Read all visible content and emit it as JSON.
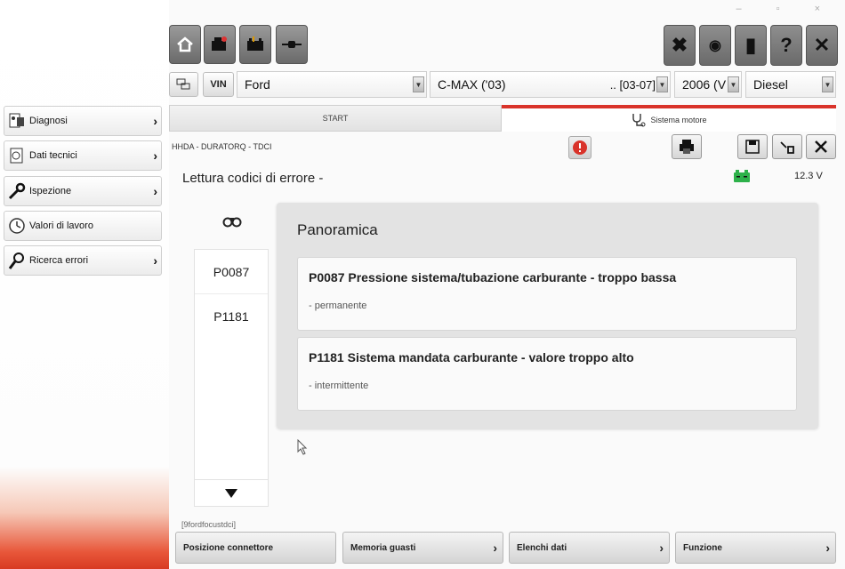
{
  "window": {
    "controls": "– ▫ ×"
  },
  "sidebar": {
    "items": [
      {
        "label": "Diagnosi",
        "icon": "diagnosis-icon"
      },
      {
        "label": "Dati tecnici",
        "icon": "technical-data-icon"
      },
      {
        "label": "Ispezione",
        "icon": "wrench-icon"
      },
      {
        "label": "Valori di lavoro",
        "icon": "clock-icon"
      },
      {
        "label": "Ricerca errori",
        "icon": "search-errors-icon"
      }
    ]
  },
  "toolbar": {
    "left": [
      "home-icon",
      "engine-icon",
      "battery-icon",
      "connector-icon"
    ],
    "right_labels": {
      "settings": "✖",
      "disc": "◉",
      "book": "▮",
      "help": "?",
      "close": "✕"
    }
  },
  "vehicle": {
    "vin_label": "VIN",
    "make": "Ford",
    "model": "C-MAX ('03)",
    "model_range": ".. [03-07]",
    "year": "2006 (V",
    "fuel": "Diesel"
  },
  "tabs": {
    "start": "START",
    "sistema": "Sistema motore"
  },
  "content": {
    "breadcrumb": "HHDA - DURATORQ - TDCI",
    "section_title": "Lettura codici di errore -",
    "voltage": "12.3 V"
  },
  "codes": [
    "P0087",
    "P1181"
  ],
  "overview": {
    "title": "Panoramica",
    "faults": [
      {
        "title": "P0087 Pressione sistema/tubazione carburante - troppo bassa",
        "status": "- permanente"
      },
      {
        "title": "P1181 Sistema mandata carburante - valore troppo alto",
        "status": "- intermittente"
      }
    ]
  },
  "footer": {
    "id": "[9fordfocustdci]",
    "buttons": [
      "Posizione connettore",
      "Memoria guasti",
      "Elenchi dati",
      "Funzione"
    ]
  },
  "colors": {
    "accent": "#d9332a",
    "battery": "#2db14a"
  }
}
